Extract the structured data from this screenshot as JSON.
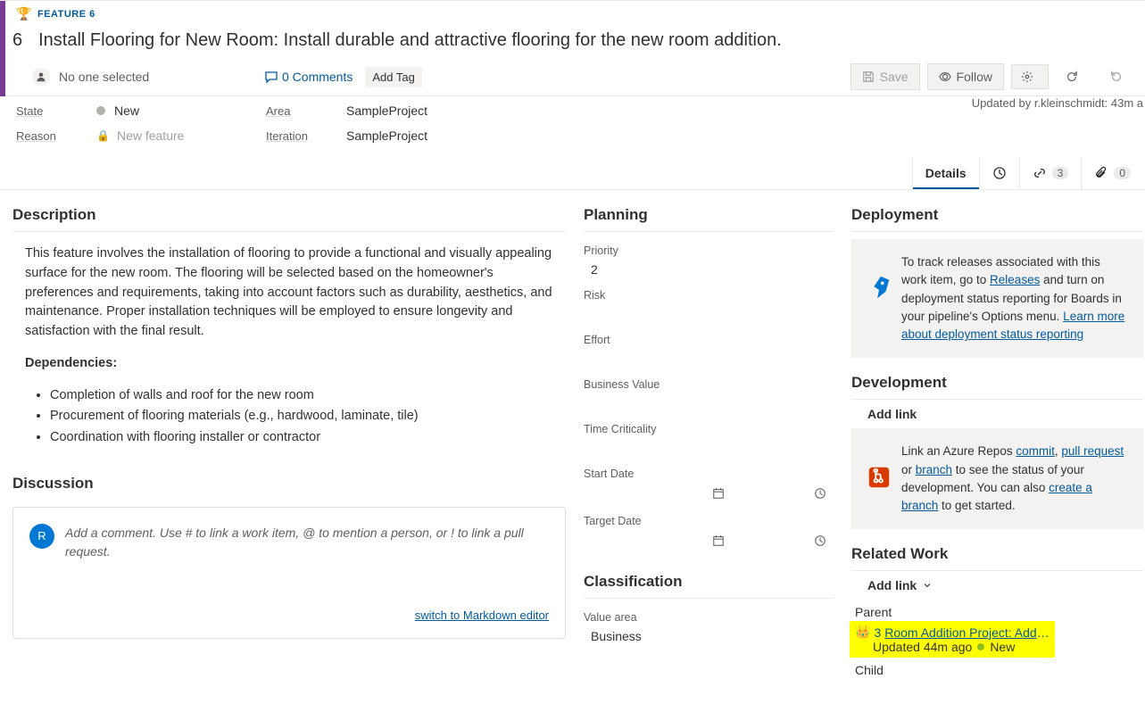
{
  "feature": {
    "type_label": "FEATURE 6",
    "id": "6",
    "title": "Install Flooring for New Room: Install durable and attractive flooring for the new room addition."
  },
  "toolbar": {
    "assignee": "No one selected",
    "comments": "0 Comments",
    "add_tag": "Add Tag",
    "save": "Save",
    "follow": "Follow"
  },
  "meta": {
    "state_label": "State",
    "state_value": "New",
    "reason_label": "Reason",
    "reason_value": "New feature",
    "area_label": "Area",
    "area_value": "SampleProject",
    "iteration_label": "Iteration",
    "iteration_value": "SampleProject",
    "updated_by": "Updated by r.kleinschmidt: 43m a"
  },
  "tabs": {
    "details": "Details",
    "links_count": "3",
    "attach_count": "0"
  },
  "description": {
    "heading": "Description",
    "body": "This feature involves the installation of flooring to provide a functional and visually appealing surface for the new room. The flooring will be selected based on the homeowner's preferences and requirements, taking into account factors such as durability, aesthetics, and maintenance. Proper installation techniques will be employed to ensure longevity and satisfaction with the final result.",
    "deps_heading": "Dependencies:",
    "deps": [
      "Completion of walls and roof for the new room",
      "Procurement of flooring materials (e.g., hardwood, laminate, tile)",
      "Coordination with flooring installer or contractor"
    ]
  },
  "discussion": {
    "heading": "Discussion",
    "avatar_letter": "R",
    "placeholder": "Add a comment. Use # to link a work item, @ to mention a person, or ! to link a pull request.",
    "switch": "switch to Markdown editor"
  },
  "planning": {
    "heading": "Planning",
    "priority_label": "Priority",
    "priority_value": "2",
    "risk_label": "Risk",
    "effort_label": "Effort",
    "bv_label": "Business Value",
    "tc_label": "Time Criticality",
    "start_label": "Start Date",
    "target_label": "Target Date"
  },
  "classification": {
    "heading": "Classification",
    "va_label": "Value area",
    "va_value": "Business"
  },
  "deployment": {
    "heading": "Deployment",
    "text1": "To track releases associated with this work item, go to ",
    "releases": "Releases",
    "text2": " and turn on deployment status reporting for Boards in your pipeline's Options menu. ",
    "learn": "Learn more about deployment status reporting"
  },
  "development": {
    "heading": "Development",
    "add_link": "Add link",
    "text1": "Link an Azure Repos ",
    "commit": "commit",
    "pr": "pull request",
    "or": " or ",
    "branch": "branch",
    "text2": " to see the status of your development. You can also ",
    "create": "create a branch",
    "text3": " to get started."
  },
  "related": {
    "heading": "Related Work",
    "add_link": "Add link",
    "parent_label": "Parent",
    "parent_id": "3",
    "parent_title": "Room Addition Project: Adding a new r...",
    "parent_updated": "Updated 44m ago",
    "parent_state": "New",
    "child_label": "Child"
  }
}
